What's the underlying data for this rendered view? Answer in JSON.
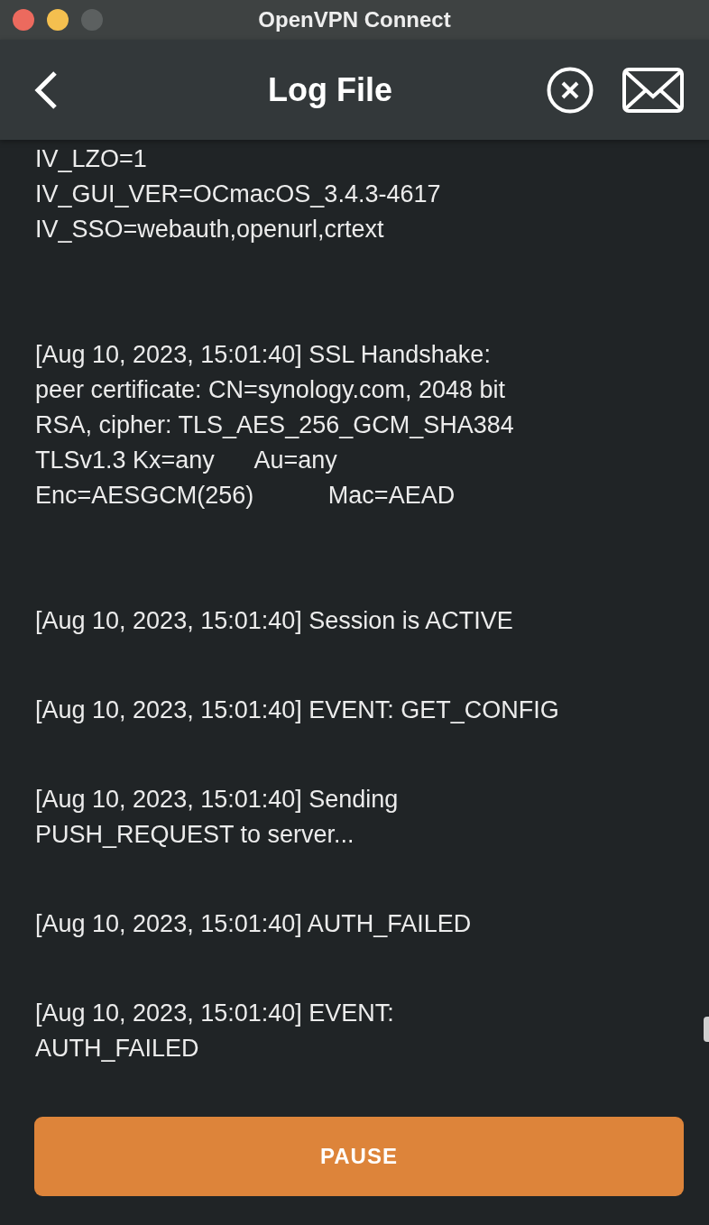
{
  "window": {
    "title": "OpenVPN Connect"
  },
  "header": {
    "title": "Log File"
  },
  "log_entries": [
    {
      "lines": [
        "IV_LZO=1",
        "IV_GUI_VER=OCmacOS_3.4.3-4617",
        "IV_SSO=webauth,openurl,crtext"
      ]
    },
    {
      "lines": [
        "[Aug 10, 2023, 15:01:40] SSL Handshake:",
        "peer certificate: CN=synology.com, 2048 bit",
        "RSA, cipher: TLS_AES_256_GCM_SHA384",
        "TLSv1.3 Kx=any      Au=any",
        "Enc=AESGCM(256)           Mac=AEAD"
      ]
    },
    {
      "lines": [
        "[Aug 10, 2023, 15:01:40] Session is ACTIVE"
      ]
    },
    {
      "lines": [
        "[Aug 10, 2023, 15:01:40] EVENT: GET_CONFIG"
      ]
    },
    {
      "lines": [
        "[Aug 10, 2023, 15:01:40] Sending",
        "PUSH_REQUEST to server..."
      ]
    },
    {
      "lines": [
        "[Aug 10, 2023, 15:01:40] AUTH_FAILED"
      ]
    },
    {
      "lines": [
        "[Aug 10, 2023, 15:01:40] EVENT:",
        "AUTH_FAILED"
      ]
    }
  ],
  "action_button": {
    "label": "PAUSE"
  }
}
